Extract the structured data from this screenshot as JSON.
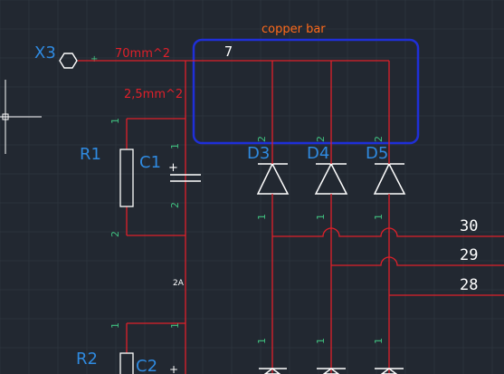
{
  "colors": {
    "background": "#222831",
    "grid": "#2b323c",
    "wire": "#e0202a",
    "symbol": "#ffffff",
    "ref_label": "#2f8ae0",
    "pin_number": "#3fbf7f",
    "annotation": "#ff6a1a",
    "highlight_box": "#1f2fd8",
    "text_white": "#ffffff"
  },
  "connector": {
    "label": "X3",
    "plus_mark": "+"
  },
  "wire_labels": {
    "main_cross_section": "70mm^2",
    "branch_cross_section": "2,5mm^2"
  },
  "copper_bar": {
    "annotation": "copper bar",
    "node_number": "7"
  },
  "components": {
    "r1": {
      "label": "R1",
      "pin_top": "1",
      "pin_bottom": "2"
    },
    "c1": {
      "label": "C1",
      "pin_top": "1",
      "pin_bottom": "2",
      "polarity": "+"
    },
    "d3": {
      "label": "D3",
      "pin_top": "2",
      "pin_bottom": "1"
    },
    "d4": {
      "label": "D4",
      "pin_top": "2",
      "pin_bottom": "1"
    },
    "d5": {
      "label": "D5",
      "pin_top": "2",
      "pin_bottom": "1"
    },
    "r2": {
      "label": "R2",
      "pin_top": "1"
    },
    "c2": {
      "label": "C2",
      "polarity": "+"
    }
  },
  "fuse_label": "2A",
  "lower_pins": {
    "pin_left": "1",
    "pin_d3": "1",
    "pin_d4": "1",
    "pin_d5": "1"
  },
  "net_numbers": [
    "30",
    "29",
    "28"
  ],
  "cursor": {
    "type": "crosshair"
  }
}
